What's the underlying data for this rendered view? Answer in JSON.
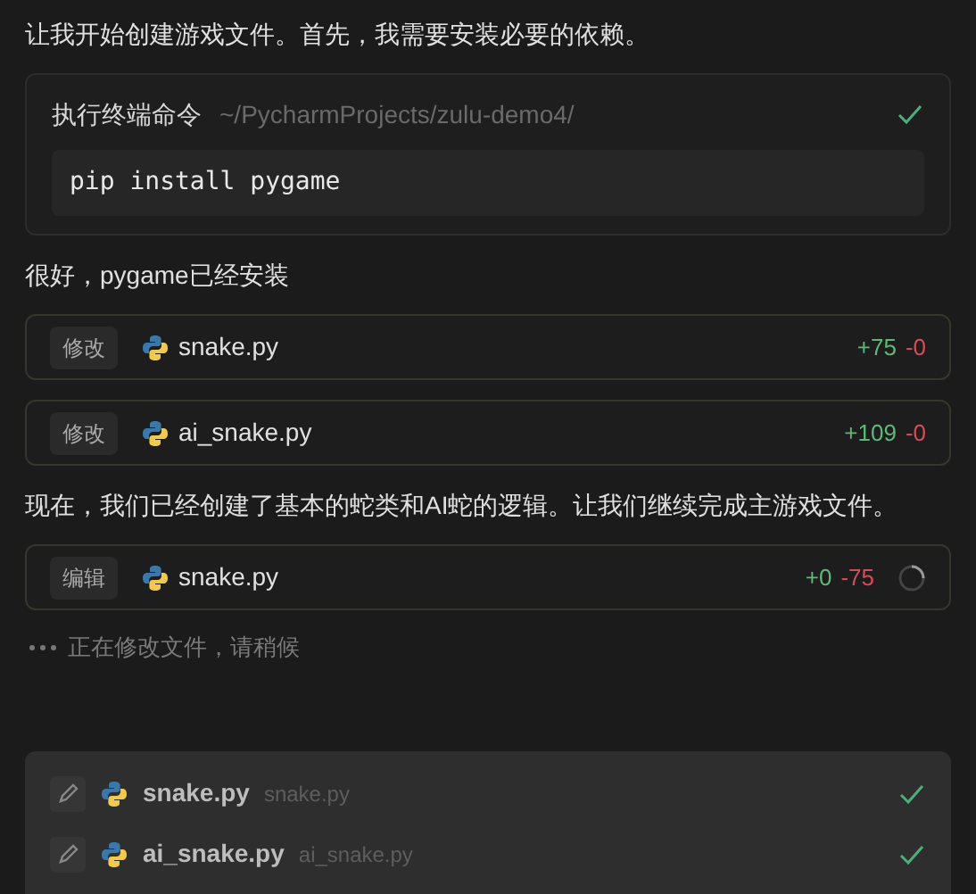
{
  "messages": [
    {
      "kind": "text",
      "text": "让我开始创建游戏文件。首先，我需要安装必要的依赖。"
    },
    {
      "kind": "terminal",
      "title": "执行终端命令",
      "path": "~/PycharmProjects/zulu-demo4/",
      "command": "pip install pygame",
      "done": true
    },
    {
      "kind": "text",
      "text": "很好，pygame已经安装"
    },
    {
      "kind": "file",
      "action": "修改",
      "file": "snake.py",
      "added": "+75",
      "removed": "-0",
      "loading": false
    },
    {
      "kind": "file",
      "action": "修改",
      "file": "ai_snake.py",
      "added": "+109",
      "removed": "-0",
      "loading": false
    },
    {
      "kind": "text",
      "text": "现在，我们已经创建了基本的蛇类和AI蛇的逻辑。让我们继续完成主游戏文件。"
    },
    {
      "kind": "file",
      "action": "编辑",
      "file": "snake.py",
      "added": "+0",
      "removed": "-75",
      "loading": true
    },
    {
      "kind": "status",
      "text": "正在修改文件，请稍候"
    }
  ],
  "changed_files": [
    {
      "name": "snake.py",
      "path": "snake.py",
      "done": true
    },
    {
      "name": "ai_snake.py",
      "path": "ai_snake.py",
      "done": true
    }
  ]
}
